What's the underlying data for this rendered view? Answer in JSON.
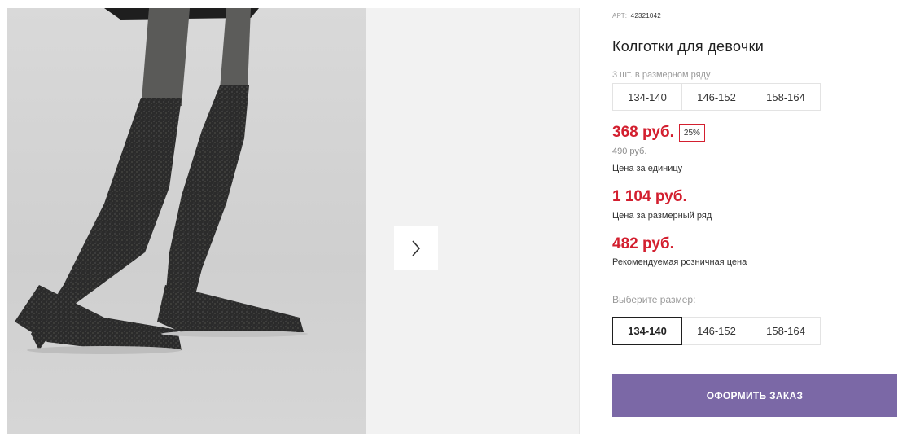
{
  "gallery": {
    "next_icon": "chevron-right-icon"
  },
  "product": {
    "sku_label": "АРТ:",
    "sku_value": "42321042",
    "title": "Колготки для девочки",
    "pack_label": "3 шт. в размерном ряду",
    "pack_sizes": [
      "134-140",
      "146-152",
      "158-164"
    ],
    "price": "368 руб.",
    "discount": "25%",
    "old_price": "490 руб.",
    "price_caption": "Цена за единицу",
    "pack_price": "1 104 руб.",
    "pack_price_caption": "Цена за размерный ряд",
    "retail_price": "482 руб.",
    "retail_price_caption": "Рекомендуемая розничная цена",
    "choose_label": "Выберите размер:",
    "sizes": [
      "134-140",
      "146-152",
      "158-164"
    ],
    "selected_size": "134-140",
    "order_button": "ОФОРМИТЬ ЗАКАЗ"
  },
  "colors": {
    "accent_red": "#d31f2f",
    "order_button": "#7b68a6"
  }
}
